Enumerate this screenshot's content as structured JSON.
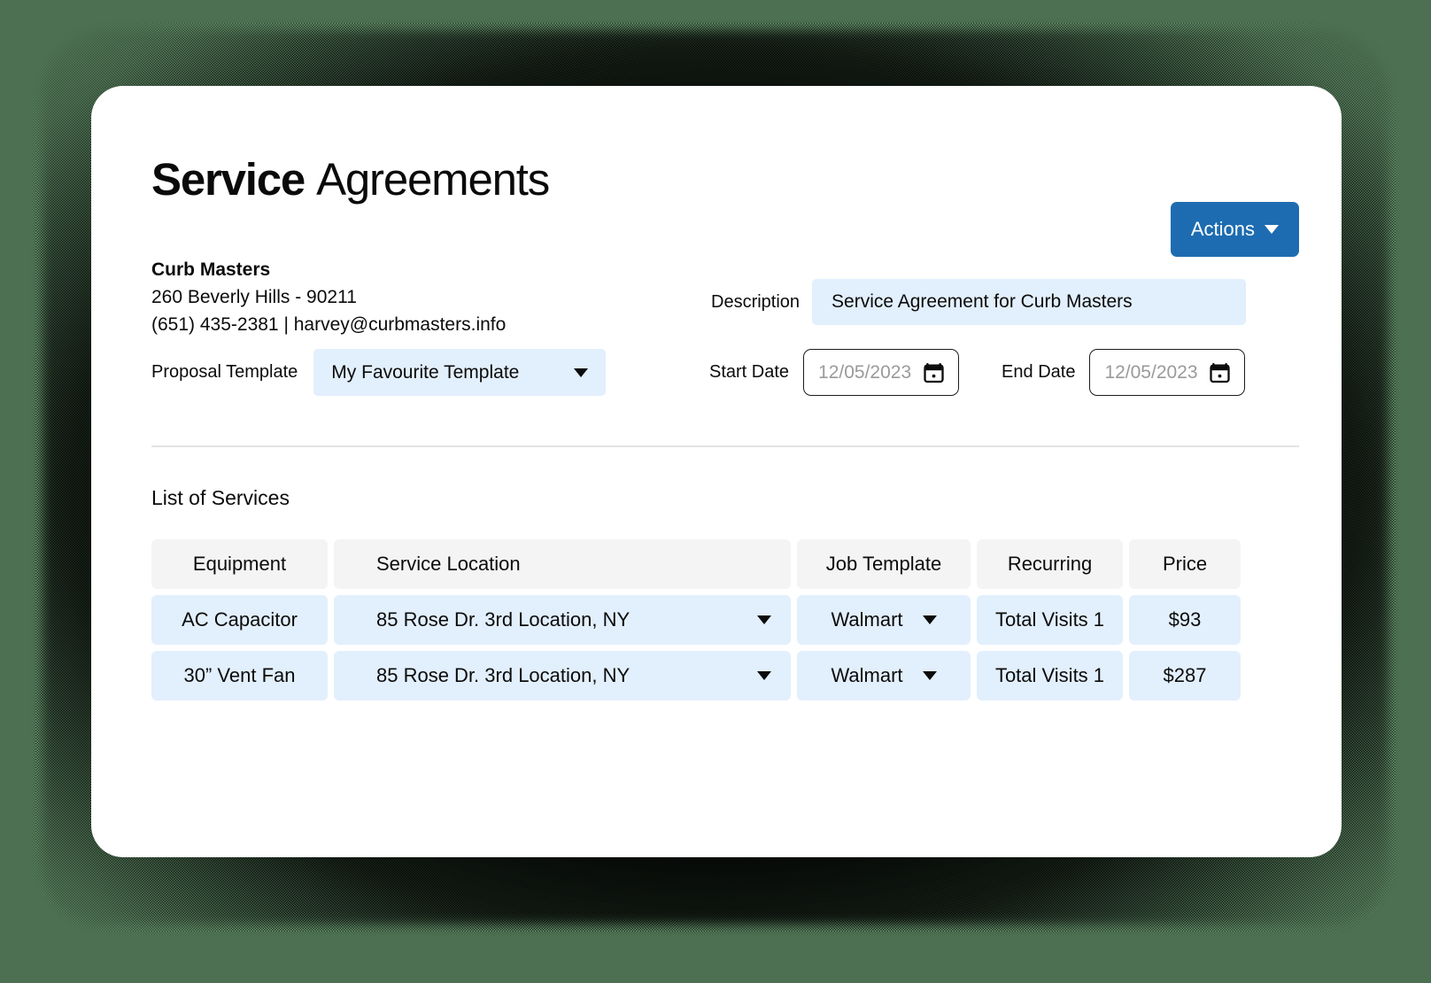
{
  "page": {
    "title_strong": "Service",
    "title_light": "Agreements"
  },
  "toolbar": {
    "actions_label": "Actions",
    "actions_caret_icon": "chevron-down-icon",
    "accent_color": "#1d6cb1"
  },
  "contact": {
    "name": "Curb Masters",
    "address": "260 Beverly Hills - 90211",
    "phone_email": "(651) 435-2381 | harvey@curbmasters.info"
  },
  "form": {
    "description_label": "Description",
    "description_value": "Service Agreement for Curb Masters",
    "proposal_template_label": "Proposal Template",
    "proposal_template_value": "My Favourite Template",
    "proposal_caret_icon": "chevron-down-icon",
    "start_date_label": "Start Date",
    "start_date_placeholder": "12/05/2023",
    "end_date_label": "End Date",
    "end_date_placeholder": "12/05/2023",
    "calendar_icon": "calendar-icon",
    "field_bg_color": "#e2effc"
  },
  "services": {
    "heading": "List of Services",
    "columns": [
      "Equipment",
      "Service Location",
      "Job Template",
      "Recurring",
      "Price"
    ],
    "rows": [
      {
        "equipment": "AC Capacitor",
        "location": "85 Rose Dr. 3rd Location, NY",
        "location_caret_icon": "chevron-down-icon",
        "job_template": "Walmart",
        "job_caret_icon": "chevron-down-icon",
        "recurring": "Total Visits 1",
        "price": "$93"
      },
      {
        "equipment": "30” Vent Fan",
        "location": "85 Rose Dr. 3rd Location, NY",
        "location_caret_icon": "chevron-down-icon",
        "job_template": "Walmart",
        "job_caret_icon": "chevron-down-icon",
        "recurring": "Total Visits 1",
        "price": "$287"
      }
    ]
  }
}
